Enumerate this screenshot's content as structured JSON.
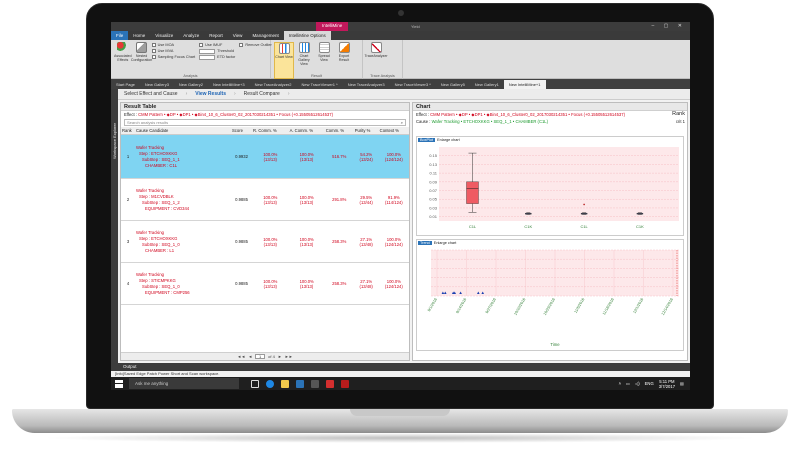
{
  "window": {
    "context_tab": "IntelliMine",
    "app_title": "<b>Yield</b>"
  },
  "menu": [
    "File",
    "Home",
    "Visualize",
    "Analyze",
    "Report",
    "View",
    "Management",
    "IntelliMine Options"
  ],
  "ribbon": {
    "analysis": {
      "label": "Analysis",
      "buttons": [
        {
          "label": "Associated Effects"
        },
        {
          "label": "Nested Configuration"
        }
      ],
      "checks": [
        "Use MOA",
        "Use MVA",
        "Sampling Focus Chart"
      ],
      "checks2": [
        "Use IMUF",
        "Threshold",
        "ETD factor"
      ],
      "checks3": [
        "Remove Outlier"
      ]
    },
    "result": {
      "label": "Result",
      "buttons": [
        {
          "label": "Chart View",
          "active": true
        },
        {
          "label": "Chart Gallery View"
        },
        {
          "label": "Spread View"
        },
        {
          "label": "Export Result"
        }
      ]
    },
    "trace": {
      "label": "Trace Analysis",
      "buttons": [
        {
          "label": "TraceAnalyzer"
        }
      ]
    }
  },
  "doc_tabs": [
    "Start Page",
    "New Gallery3",
    "New Gallery2",
    "New IntelliMine+3",
    "New TraceAnalyzer2",
    "New TraceViewer1 *",
    "New TraceAnalyzer3",
    "New TraceViewer3 *",
    "New Gallery5",
    "New Gallery1",
    "New IntelliMine+1"
  ],
  "active_tab_index": 10,
  "sidebar_label": "Workspace Explorer",
  "wizard": {
    "steps": [
      "Select Effect and Cause",
      "View Results",
      "Result Compare"
    ],
    "active": 1
  },
  "result_table": {
    "title": "Result Table",
    "effect_label": "Effect :",
    "effect_value": "CMM Pattern • ◆DP • ◆DP1 • ◆Bin4_10_6_Cluster0_02_2017030214351 • Focus (+0.15505512614537)",
    "search_placeholder": "Search analysis results",
    "columns": [
      "Rank",
      "Cause Candidate",
      "Score",
      "R. Comm. %",
      "A. Comm. %",
      "Comm. %",
      "Purity %",
      "Context %"
    ],
    "rows": [
      {
        "rank": "1",
        "c1": "Wafer Tracking",
        "c2": "Step : ETCHOXKKG",
        "c3": "SubStep : SEQ_1_1",
        "c4": "CHAMBER : C1L",
        "score": "0.9932",
        "r_comm": "100.0%",
        "r_comm_sub": "(13/13)",
        "a_comm": "100.0%",
        "a_comm_sub": "(13/13)",
        "comm": "516.7%",
        "purity": "54.2%",
        "purity_sub": "(13/24)",
        "context": "100.0%",
        "context_sub": "(124/124)",
        "selected": true
      },
      {
        "rank": "2",
        "c1": "Wafer Tracking",
        "c2": "Step : M1CVDBLK",
        "c3": "SubStep : SEQ_1_2",
        "c4": "EQUIPMENT : CVD344",
        "score": "0.9885",
        "r_comm": "100.0%",
        "r_comm_sub": "(13/13)",
        "a_comm": "100.0%",
        "a_comm_sub": "(13/13)",
        "comm": "291.8%",
        "purity": "29.5%",
        "purity_sub": "(13/44)",
        "context": "91.9%",
        "context_sub": "(114/124)",
        "selected": false
      },
      {
        "rank": "3",
        "c1": "Wafer Tracking",
        "c2": "Step : ETCHOXKKG",
        "c3": "SubStep : SEQ_1_0",
        "c4": "CHAMBER : L1",
        "score": "0.9885",
        "r_comm": "100.0%",
        "r_comm_sub": "(13/13)",
        "a_comm": "100.0%",
        "a_comm_sub": "(13/13)",
        "comm": "258.3%",
        "purity": "27.1%",
        "purity_sub": "(13/48)",
        "context": "100.0%",
        "context_sub": "(124/124)",
        "selected": false
      },
      {
        "rank": "4",
        "c1": "Wafer Tracking",
        "c2": "Step : STICMPKKG",
        "c3": "SubStep : SEQ_1_0",
        "c4": "EQUIPMENT : CMP256",
        "score": "0.9885",
        "r_comm": "100.0%",
        "r_comm_sub": "(13/13)",
        "a_comm": "100.0%",
        "a_comm_sub": "(13/13)",
        "comm": "258.3%",
        "purity": "27.1%",
        "purity_sub": "(13/48)",
        "context": "100.0%",
        "context_sub": "(124/124)",
        "selected": false
      }
    ],
    "pager": {
      "page": "1",
      "total": "of 4"
    }
  },
  "chart_panel": {
    "title": "Chart",
    "rank_label": "Rank",
    "effect_label": "Effect :",
    "effect_value": "CMM Pattern • ◆DP • ◆DP1 • ◆Bin4_10_6_Cluster0_02_2017030214351 • Focus (+0.15505512614537)",
    "cause_label": "Cause :",
    "cause_value": "Wafer Tracking • ETCHOXKKG • SEQ_1_1 • CHAMBER (C1L)",
    "crit_label": "crit 1",
    "top_chart": {
      "tab": "BoxPlot",
      "enlarge": "Enlarge chart"
    },
    "bottom_chart": {
      "tab": "Trend",
      "enlarge": "Enlarge chart",
      "xlabel": "Time"
    }
  },
  "chart_data": [
    {
      "type": "box",
      "categories": [
        "C1L",
        "C1K",
        "C1L",
        "C1K"
      ],
      "ylim": [
        0,
        0.17
      ],
      "yticks": [
        "0.15",
        "0.13",
        "0.11",
        "0.09",
        "0.07",
        "0.05",
        "0.03",
        "0.01"
      ],
      "boxes": [
        {
          "min": 0.02,
          "q1": 0.04,
          "median": 0.075,
          "q3": 0.09,
          "max": 0.156
        },
        {
          "min": 0.015,
          "q1": 0.016,
          "median": 0.017,
          "q3": 0.018,
          "max": 0.019
        },
        {
          "min": 0.015,
          "q1": 0.016,
          "median": 0.017,
          "q3": 0.018,
          "max": 0.019,
          "outlier": 0.038
        },
        {
          "min": 0.015,
          "q1": 0.016,
          "median": 0.017,
          "q3": 0.018,
          "max": 0.019
        }
      ],
      "grid": true
    },
    {
      "type": "scatter",
      "xlabel": "Time",
      "xticks": [
        "9/1/2016",
        "9/14/2016",
        "9/27/2016",
        "10/10/2016",
        "10/23/2016",
        "11/5/2016",
        "11/18/2016",
        "12/1/2016",
        "12/14/2016"
      ],
      "points": [
        {
          "x": 0.2,
          "y": 0.01
        },
        {
          "x": 0.28,
          "y": 0.01
        },
        {
          "x": 0.55,
          "y": 0.01
        },
        {
          "x": 0.6,
          "y": 0.01
        },
        {
          "x": 0.8,
          "y": 0.01
        },
        {
          "x": 1.4,
          "y": 0.01
        },
        {
          "x": 1.55,
          "y": 0.01
        }
      ]
    }
  ],
  "output": {
    "label": "Output"
  },
  "status": {
    "text": "[Info]Saved Edge Patch Power Short and Scan workspace."
  },
  "taskbar": {
    "search_placeholder": "Ask me anything",
    "lang": "ENG",
    "time": "5:11 PM",
    "date": "3/7/2017"
  },
  "colors": {
    "accent_red": "#d0021b",
    "selection": "#7fd4f2",
    "ribbon_active": "#fbe49a",
    "context_tab": "#c2185b",
    "file_blue": "#2b73b7"
  }
}
